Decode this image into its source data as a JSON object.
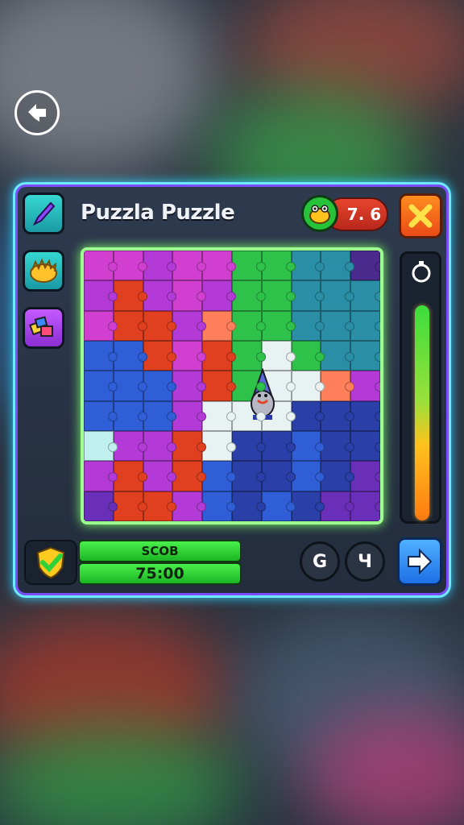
{
  "header": {
    "title": "Puzzla Puzzle"
  },
  "score": {
    "value": "7. 6"
  },
  "footer": {
    "label_top": "SCOB",
    "label_bottom": "75:00",
    "btn_left": "G",
    "btn_right": "Ч"
  },
  "timer": {
    "level_fraction": 0.92
  },
  "icons": {
    "back": "back-arrow-icon",
    "brush": "paintbrush-icon",
    "fur": "yellow-sponge-icon",
    "blocks": "blocks-icon",
    "frog": "frog-icon",
    "close": "close-icon",
    "timer": "stopwatch-icon",
    "check": "shield-check-icon",
    "next": "arrow-right-icon"
  },
  "colors": {
    "panel_border": "#6ee9ff",
    "board_glow": "#9dff8f",
    "close": "#ff7a1f",
    "next": "#3f9cff"
  }
}
